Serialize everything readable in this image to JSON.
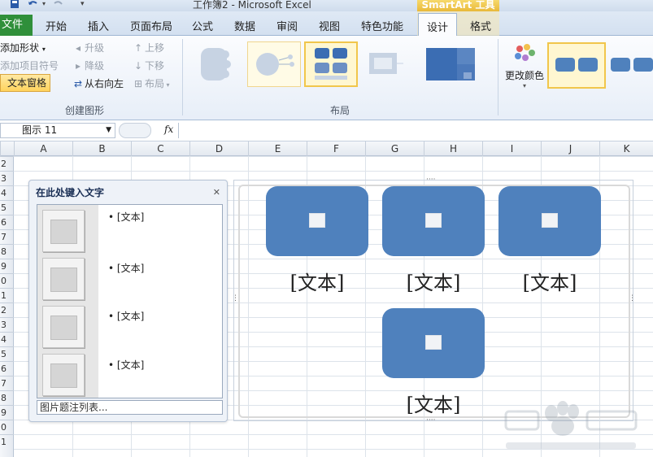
{
  "window": {
    "title": "工作簿2 - Microsoft Excel",
    "contextual_tab_group": "SmartArt 工具"
  },
  "tabs": [
    {
      "label": "文件"
    },
    {
      "label": "开始"
    },
    {
      "label": "插入"
    },
    {
      "label": "页面布局"
    },
    {
      "label": "公式"
    },
    {
      "label": "数据"
    },
    {
      "label": "审阅"
    },
    {
      "label": "视图"
    },
    {
      "label": "特色功能"
    },
    {
      "label": "设计"
    },
    {
      "label": "格式"
    }
  ],
  "ribbon": {
    "create_graphic": {
      "add_shape": "添加形状",
      "add_bullet": "添加项目符号",
      "text_pane": "文本窗格",
      "promote": "升级",
      "demote": "降级",
      "right_to_left": "从右向左",
      "move_up": "上移",
      "move_down": "下移",
      "layout": "布局",
      "group_label": "创建图形"
    },
    "layouts": {
      "group_label": "布局"
    },
    "change_colors": "更改颜色"
  },
  "formula_bar": {
    "name_box": "图示 11",
    "fx_label": "fx",
    "formula": ""
  },
  "columns": [
    "A",
    "B",
    "C",
    "D",
    "E",
    "F",
    "G",
    "H",
    "I",
    "J",
    "K"
  ],
  "rows": [
    "2",
    "3",
    "4",
    "5",
    "6",
    "7",
    "8",
    "9",
    "0",
    "1",
    "2",
    "3",
    "4",
    "5",
    "6",
    "7",
    "8",
    "9",
    "0",
    "1"
  ],
  "text_pane": {
    "title": "在此处键入文字",
    "items": [
      {
        "text": "[文本]"
      },
      {
        "text": "[文本]"
      },
      {
        "text": "[文本]"
      },
      {
        "text": "[文本]"
      }
    ],
    "footer": "图片题注列表..."
  },
  "smartart": {
    "shapes": [
      {
        "caption": "[文本]"
      },
      {
        "caption": "[文本]"
      },
      {
        "caption": "[文本]"
      },
      {
        "caption": "[文本]"
      }
    ],
    "fill_color": "#4f81bd"
  },
  "colors": {
    "file_tab": "#2f8f3a",
    "selection": "#f1c64b",
    "shape_fill": "#4f81bd"
  }
}
